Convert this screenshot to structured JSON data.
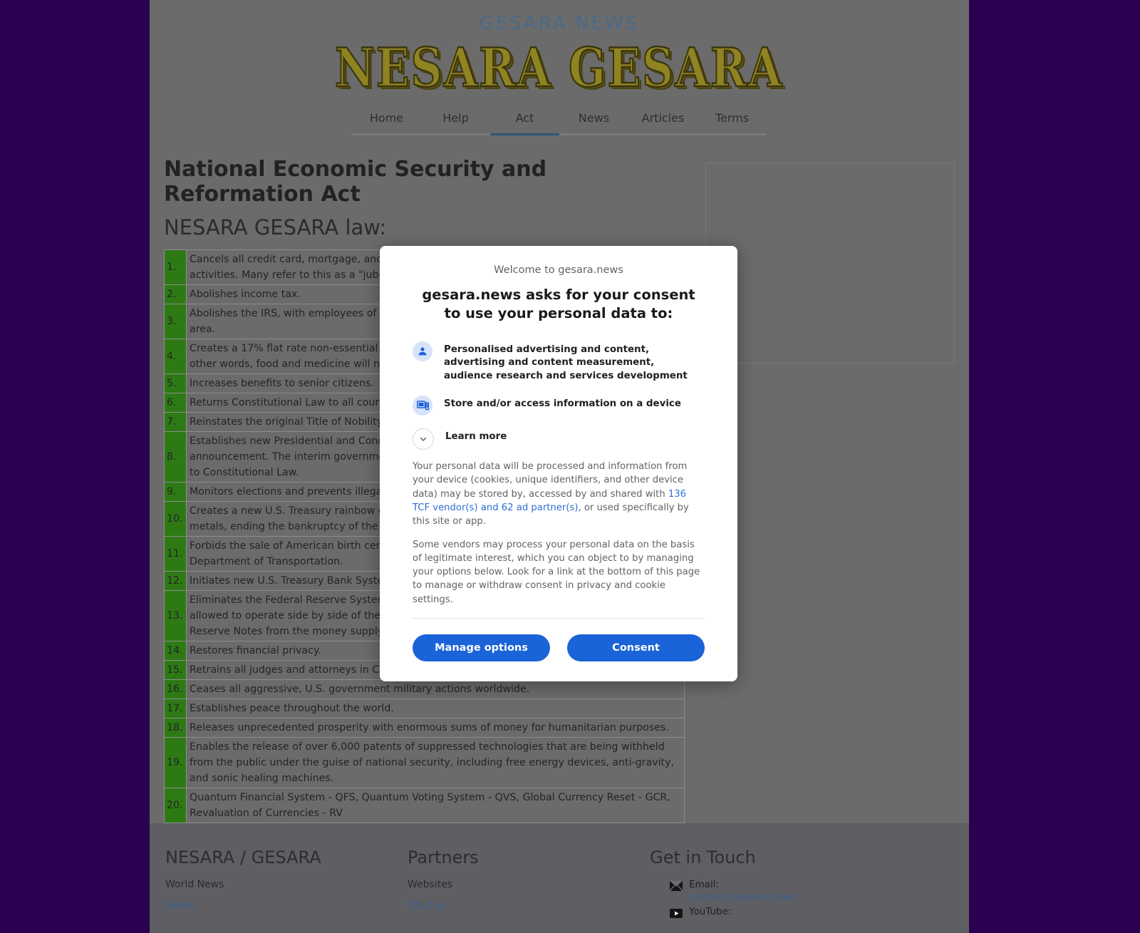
{
  "site": {
    "name": "GESARA.NEWS",
    "logo": "NESARA GESARA"
  },
  "nav": {
    "items": [
      {
        "label": "Home",
        "active": false
      },
      {
        "label": "Help",
        "active": false
      },
      {
        "label": "Act",
        "active": true
      },
      {
        "label": "News",
        "active": false
      },
      {
        "label": "Articles",
        "active": false
      },
      {
        "label": "Terms",
        "active": false
      }
    ]
  },
  "main": {
    "title": "National Economic Security and Reformation Act",
    "subtitle": "NESARA GESARA law:",
    "table": {
      "rows": [
        {
          "num": "1.",
          "text": "Cancels all credit card, mortgage, and other bank debt due to illegal banking and government activities. Many refer to this as a \"jubilee\" or complete forgiveness of debt."
        },
        {
          "num": "2.",
          "text": "Abolishes income tax."
        },
        {
          "num": "3.",
          "text": "Abolishes the IRS, with employees of the IRS transferred into the US Treasury national sales tax area."
        },
        {
          "num": "4.",
          "text": "Creates a 17% flat rate non-essential new items only sales tax revenue for the government. In other words, food and medicine will not be taxed; nor will used items such as old homes."
        },
        {
          "num": "5.",
          "text": "Increases benefits to senior citizens."
        },
        {
          "num": "6.",
          "text": "Returns Constitutional Law to all courts and legal matters."
        },
        {
          "num": "7.",
          "text": "Reinstates the original Title of Nobility amendment."
        },
        {
          "num": "8.",
          "text": "Establishes new Presidential and Congressional elections within 120 days of NESARA's announcement. The interim government will cancel all National Emergencies and return us back to Constitutional Law."
        },
        {
          "num": "9.",
          "text": "Monitors elections and prevents illegal election activities of special interest groups."
        },
        {
          "num": "10.",
          "text": "Creates a new U.S. Treasury rainbow currency backed by gold, silver, and platinum precious metals, ending the bankruptcy of the United States initiated by Franklin Roosevelt in 1933."
        },
        {
          "num": "11.",
          "text": "Forbids the sale of American birth certificate records as chattel property bonds by the US Department of Transportation."
        },
        {
          "num": "12.",
          "text": "Initiates new U.S. Treasury Bank System in alignment with Constitutional Law."
        },
        {
          "num": "13.",
          "text": "Eliminates the Federal Reserve System. During the transition period the Federal Reserve will be allowed to operate side by side of the U.S. treasury for one year in order to remove all Federal Reserve Notes from the money supply."
        },
        {
          "num": "14.",
          "text": "Restores financial privacy."
        },
        {
          "num": "15.",
          "text": "Retrains all judges and attorneys in Constitutional Law."
        },
        {
          "num": "16.",
          "text": "Ceases all aggressive, U.S. government military actions worldwide."
        },
        {
          "num": "17.",
          "text": "Establishes peace throughout the world."
        },
        {
          "num": "18.",
          "text": "Releases unprecedented prosperity with enormous sums of money for humanitarian purposes."
        },
        {
          "num": "19.",
          "text": "Enables the release of over 6,000 patents of suppressed technologies that are being withheld from the public under the guise of national security, including free energy devices, anti-gravity, and sonic healing machines."
        },
        {
          "num": "20.",
          "text": "Quantum Financial System - QFS, Quantum Voting System - QVS, Global Currency Reset - GCR, Revaluation of Currencies - RV"
        }
      ]
    }
  },
  "footer": {
    "columns": [
      {
        "title": "NESARA / GESARA",
        "subtitle": "World News",
        "links": [
          "Home"
        ]
      },
      {
        "title": "Partners",
        "subtitle": "Websites",
        "links": [
          "Qfs.live"
        ]
      }
    ],
    "contact": {
      "title": "Get in Touch",
      "email_label": "Email:",
      "email_value": "contact@gesara.news",
      "youtube_label": "YouTube:"
    }
  },
  "consent_dialog": {
    "welcome": "Welcome to gesara.news",
    "heading": "gesara.news asks for your consent to use your personal data to:",
    "purposes": [
      {
        "icon": "person-icon",
        "text": "Personalised advertising and content, advertising and content measurement, audience research and services development"
      },
      {
        "icon": "devices-icon",
        "text": "Store and/or access information on a device"
      }
    ],
    "learn_more": "Learn more",
    "paragraph1_before": "Your personal data will be processed and information from your device (cookies, unique identifiers, and other device data) may be stored by, accessed by and shared with ",
    "paragraph1_link": "136 TCF vendor(s) and 62 ad partner(s)",
    "paragraph1_after": ", or used specifically by this site or app.",
    "paragraph2": "Some vendors may process your personal data on the basis of legitimate interest, which you can object to by managing your options below. Look for a link at the bottom of this page to manage or withdraw consent in privacy and cookie settings.",
    "manage_label": "Manage options",
    "consent_label": "Consent",
    "accent_color": "#1a63d8",
    "link_color": "#2d6fd6"
  }
}
